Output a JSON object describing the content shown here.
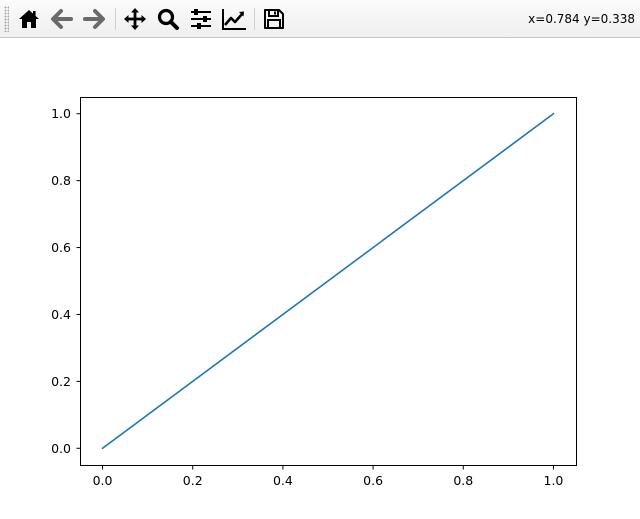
{
  "toolbar": {
    "buttons": [
      {
        "name": "home",
        "icon": "home-icon"
      },
      {
        "name": "back",
        "icon": "arrow-left-icon"
      },
      {
        "name": "forward",
        "icon": "arrow-right-icon"
      },
      {
        "name": "pan",
        "icon": "move-icon"
      },
      {
        "name": "zoom",
        "icon": "magnifier-icon"
      },
      {
        "name": "subplots",
        "icon": "sliders-icon"
      },
      {
        "name": "customize",
        "icon": "line-chart-icon"
      },
      {
        "name": "save",
        "icon": "floppy-disk-icon"
      }
    ],
    "coordinates": "x=0.784 y=0.338"
  },
  "colors": {
    "line": "#1f77b4",
    "icon_dark": "#000000",
    "icon_disabled": "#6a6a6a"
  },
  "chart_data": {
    "type": "line",
    "x": [
      0.0,
      1.0
    ],
    "series": [
      {
        "values": [
          0.0,
          1.0
        ]
      }
    ],
    "xlim": [
      -0.05,
      1.05
    ],
    "ylim": [
      -0.05,
      1.05
    ],
    "xticks": [
      "0.0",
      "0.2",
      "0.4",
      "0.6",
      "0.8",
      "1.0"
    ],
    "yticks": [
      "0.0",
      "0.2",
      "0.4",
      "0.6",
      "0.8",
      "1.0"
    ],
    "grid": false,
    "title": "",
    "xlabel": "",
    "ylabel": ""
  }
}
